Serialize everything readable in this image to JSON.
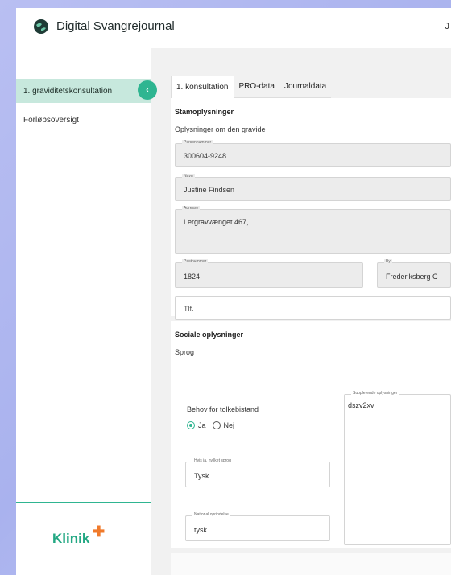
{
  "app": {
    "title": "Digital Svangrejournal",
    "user_initial": "J",
    "logo_icon": "globe-leaf-icon"
  },
  "sidebar": {
    "items": [
      {
        "label": "1. graviditetskonsultation",
        "active": true
      },
      {
        "label": "Forløbsoversigt",
        "active": false
      }
    ],
    "collapse_symbol": "‹",
    "brand": "Klinik",
    "brand_plus": "✚"
  },
  "tabs": [
    {
      "label": "1. konsultation",
      "active": true
    },
    {
      "label": "PRO-data",
      "active": false
    },
    {
      "label": "Journaldata",
      "active": false
    }
  ],
  "stamdata": {
    "title": "Stamoplysninger",
    "subtitle": "Oplysninger om den gravide",
    "cpr": {
      "label": "Personnummer",
      "value": "300604-9248"
    },
    "name": {
      "label": "Navn",
      "value": "Justine Findsen"
    },
    "address": {
      "label": "Adresse",
      "value": "Lergravvænget 467,"
    },
    "postal": {
      "label": "Postnummer",
      "value": "1824"
    },
    "city": {
      "label": "By",
      "value": "Frederiksberg C"
    },
    "phone": {
      "placeholder": "Tlf."
    }
  },
  "social": {
    "title": "Sociale oplysninger",
    "language_label": "Sprog",
    "interpreter_question": "Behov for tolkebistand",
    "option_yes": "Ja",
    "option_no": "Nej",
    "selected": "Ja",
    "which_language": {
      "label": "Hvis ja, hvilket sprog",
      "value": "Tysk"
    },
    "origin": {
      "label": "National oprindelse",
      "value": "tysk"
    },
    "extra": {
      "label": "Supplerende oplysninger",
      "value": "dszv2xv"
    }
  },
  "colors": {
    "accent": "#2fb591",
    "active_nav": "#c7e8dd",
    "brand_plus": "#f07a2b"
  }
}
